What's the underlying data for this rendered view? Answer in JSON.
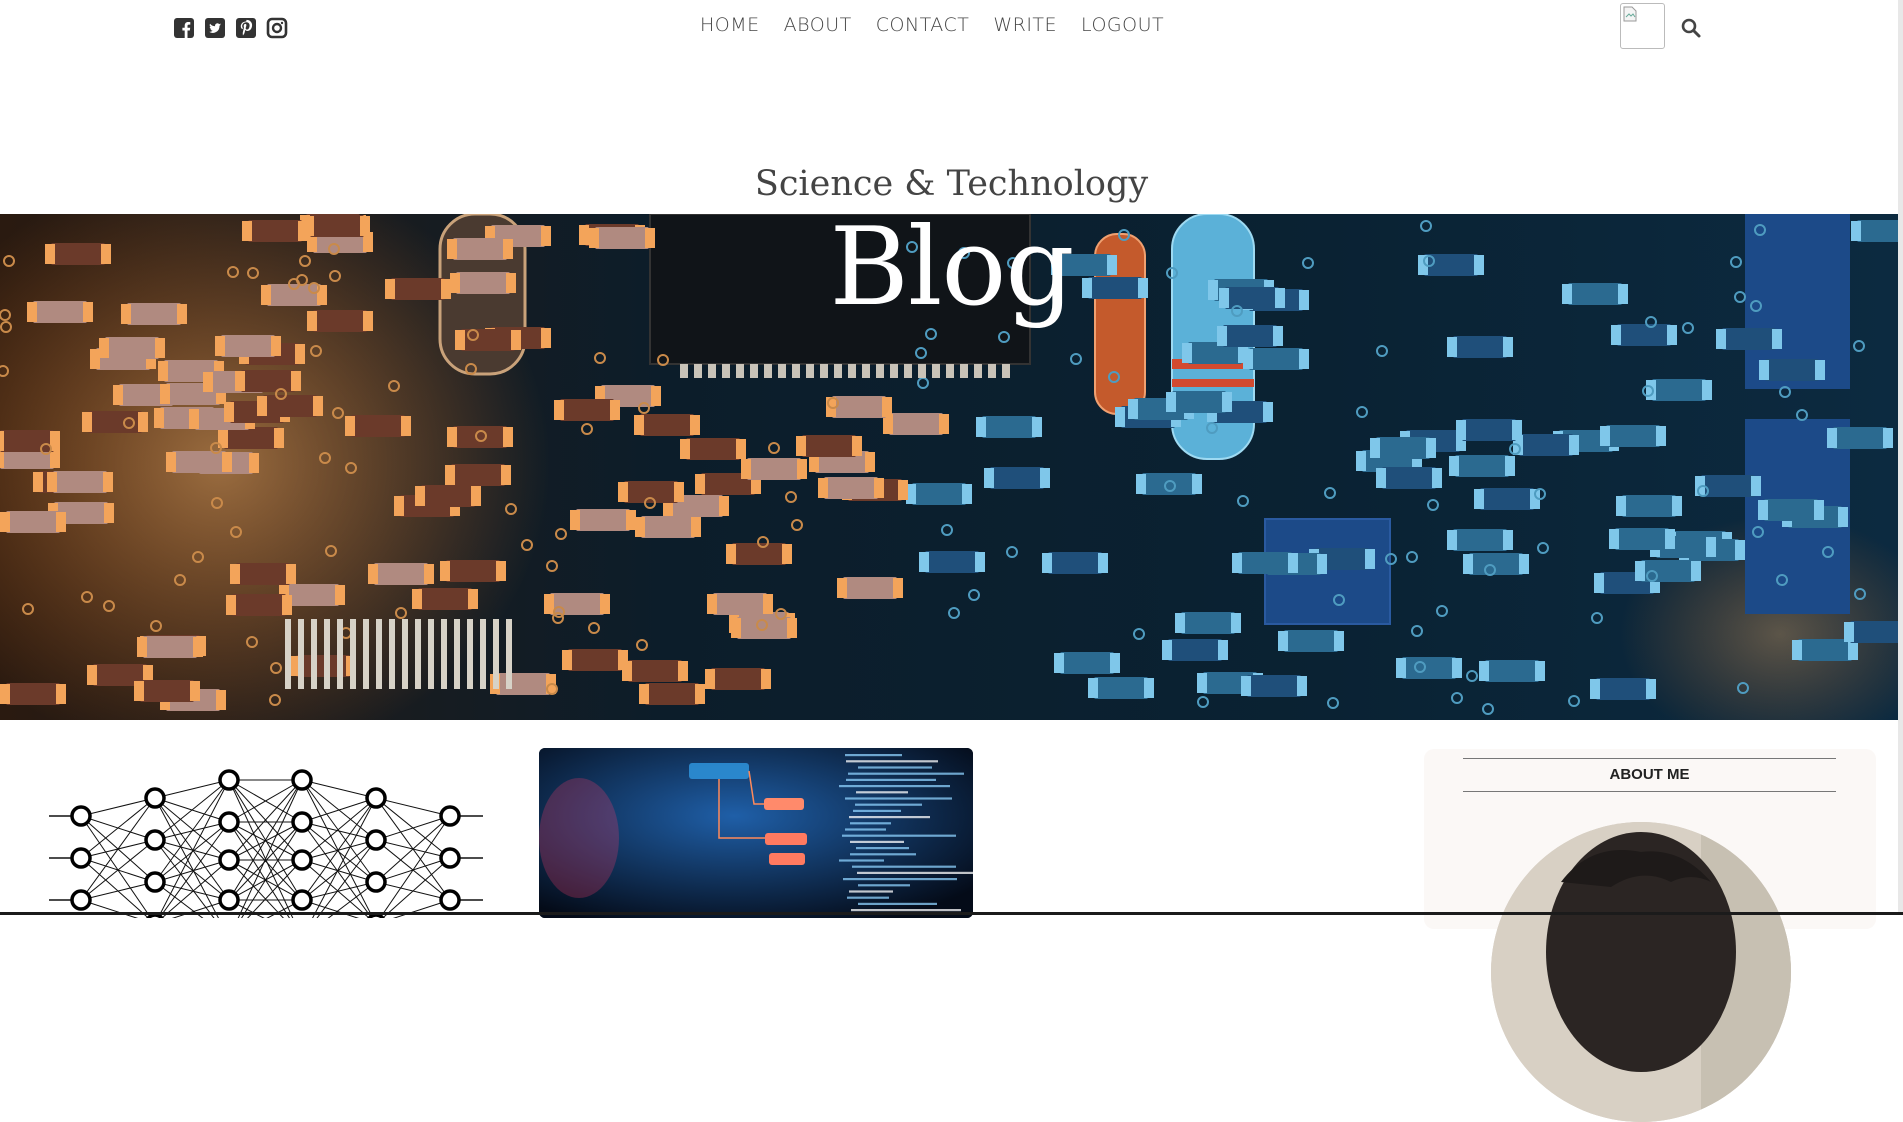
{
  "social": {
    "icons": [
      "facebook-square-icon",
      "twitter-square-icon",
      "pinterest-square-icon",
      "instagram-icon"
    ]
  },
  "nav": {
    "items": [
      "HOME",
      "ABOUT",
      "CONTACT",
      "WRITE",
      "LOGOUT"
    ]
  },
  "header": {
    "subtitle": "Science & Technology",
    "title": "Blog"
  },
  "sidebar": {
    "title": "ABOUT ME"
  },
  "colors": {
    "text": "#444444",
    "hero_dark": "#071620",
    "component_orange": "#e58a3a",
    "component_blue": "#3aa3d6",
    "sidebar_bg": "#fbf8f6"
  }
}
